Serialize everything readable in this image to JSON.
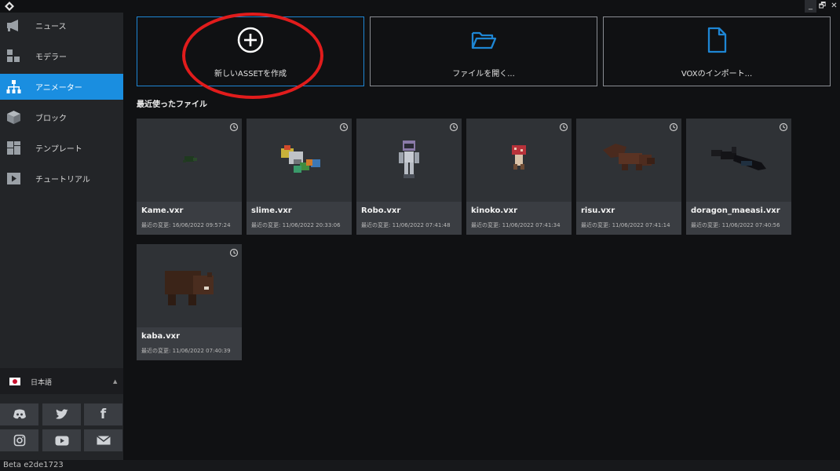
{
  "window": {
    "controls": [
      "_",
      "🗗",
      "✕"
    ]
  },
  "sidebar": {
    "items": [
      {
        "label": "ニュース",
        "icon": "megaphone-icon"
      },
      {
        "label": "モデラー",
        "icon": "blocks-icon"
      },
      {
        "label": "アニメーター",
        "icon": "hierarchy-icon",
        "active": true
      },
      {
        "label": "ブロック",
        "icon": "cube-icon"
      },
      {
        "label": "テンプレート",
        "icon": "template-icon"
      },
      {
        "label": "チュートリアル",
        "icon": "play-icon"
      }
    ],
    "language": "日本語",
    "social": [
      "discord-icon",
      "twitter-icon",
      "facebook-icon",
      "instagram-icon",
      "youtube-icon",
      "mail-icon"
    ]
  },
  "actions": [
    {
      "label": "新しいASSETを作成",
      "icon": "plus-circle-icon"
    },
    {
      "label": "ファイルを開く...",
      "icon": "folder-open-icon"
    },
    {
      "label": "VOXのインポート...",
      "icon": "file-icon"
    }
  ],
  "recent": {
    "title": "最近使ったファイル",
    "files": [
      {
        "name": "Kame.vxr",
        "modified": "最近の変更: 16/06/2022 09:57:24"
      },
      {
        "name": "slime.vxr",
        "modified": "最近の変更: 11/06/2022 20:33:06"
      },
      {
        "name": "Robo.vxr",
        "modified": "最近の変更: 11/06/2022 07:41:48"
      },
      {
        "name": "kinoko.vxr",
        "modified": "最近の変更: 11/06/2022 07:41:34"
      },
      {
        "name": "risu.vxr",
        "modified": "最近の変更: 11/06/2022 07:41:14"
      },
      {
        "name": "doragon_maeasi.vxr",
        "modified": "最近の変更: 11/06/2022 07:40:56"
      },
      {
        "name": "kaba.vxr",
        "modified": "最近の変更: 11/06/2022 07:40:39"
      }
    ]
  },
  "status": {
    "version": "Beta e2de1723"
  },
  "colors": {
    "accent": "#1a8ee0",
    "annotation": "#e11c1c",
    "sidebar": "#232528",
    "background": "#101113"
  }
}
